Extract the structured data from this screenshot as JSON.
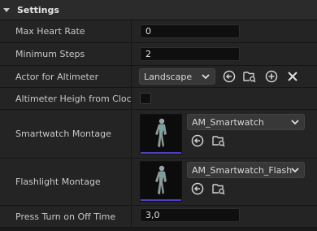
{
  "section": {
    "title": "Settings"
  },
  "rows": {
    "max_heart_rate": {
      "label": "Max Heart Rate",
      "value": "0"
    },
    "minimum_steps": {
      "label": "Minimum Steps",
      "value": "2"
    },
    "actor_for_altimeter": {
      "label": "Actor for Altimeter",
      "value": "Landscape"
    },
    "altimeter_height": {
      "label": "Altimeter Heigh from Cloc..."
    },
    "smartwatch_montage": {
      "label": "Smartwatch Montage",
      "asset": "AM_Smartwatch"
    },
    "flashlight_montage": {
      "label": "Flashlight Montage",
      "asset": "AM_Smartwatch_Flash"
    },
    "press_turn": {
      "label": "Press Turn on Off Time",
      "value": "3,0"
    }
  },
  "icons": {
    "use_selected": "arrow-left-circle-icon",
    "browse": "folder-search-icon",
    "add": "plus-circle-icon",
    "clear": "close-icon"
  }
}
